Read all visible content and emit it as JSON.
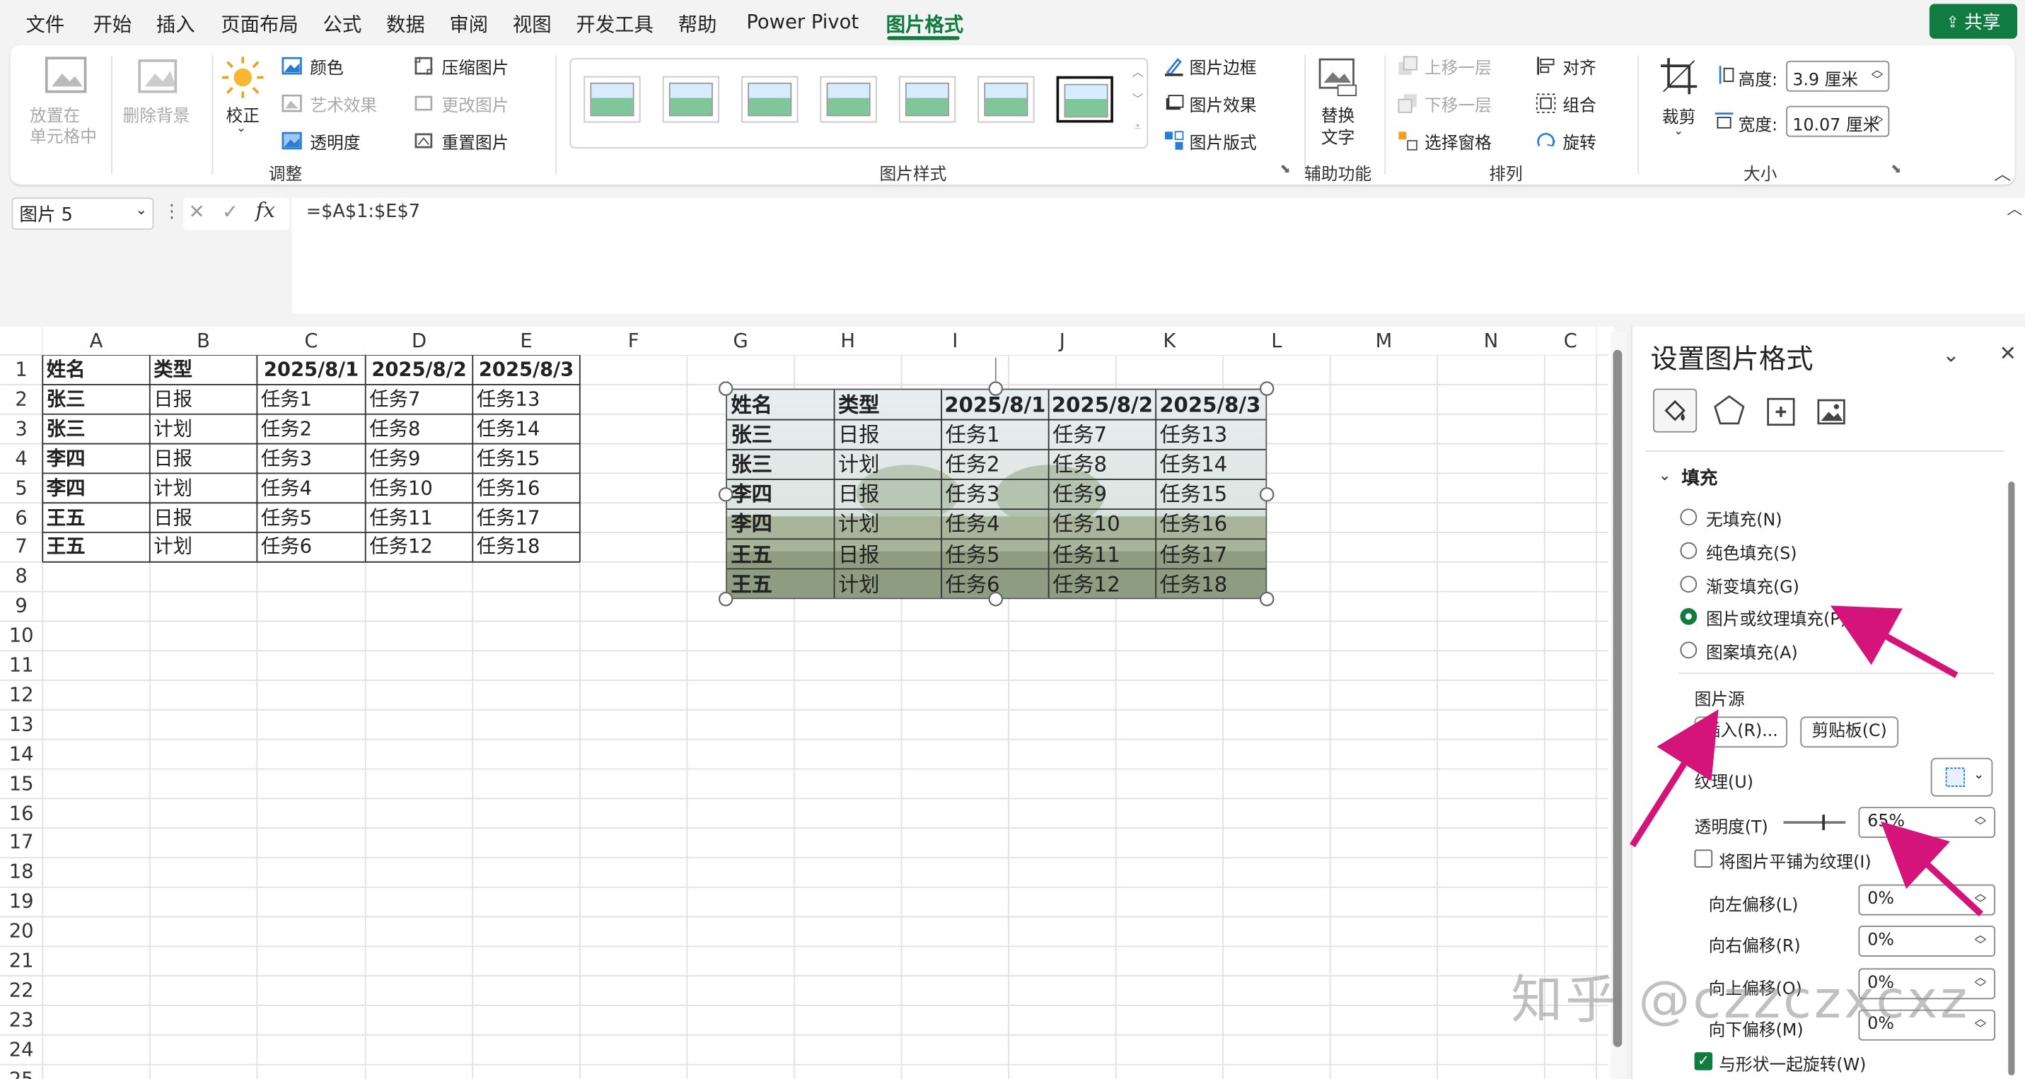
{
  "menu": {
    "items": [
      "文件",
      "开始",
      "插入",
      "页面布局",
      "公式",
      "数据",
      "审阅",
      "视图",
      "开发工具",
      "帮助",
      "Power Pivot",
      "图片格式"
    ],
    "active": "图片格式",
    "share_label": "共享",
    "accent": "#107c41"
  },
  "ribbon": {
    "adjust": {
      "group_label": "调整",
      "place_in_cell": [
        "放置在",
        "单元格中"
      ],
      "remove_bg": "删除背景",
      "correct": "校正",
      "color": "颜色",
      "artistic": "艺术效果",
      "transparency": "透明度",
      "compress": "压缩图片",
      "change": "更改图片",
      "reset": "重置图片"
    },
    "styles": {
      "group_label": "图片样式",
      "border": "图片边框",
      "effects": "图片效果",
      "layout": "图片版式"
    },
    "accessibility": {
      "group_label": "辅助功能",
      "alt_text": [
        "替换",
        "文字"
      ]
    },
    "arrange": {
      "group_label": "排列",
      "bring_forward": "上移一层",
      "send_backward": "下移一层",
      "selection_pane": "选择窗格",
      "align": "对齐",
      "group": "组合",
      "rotate": "旋转"
    },
    "size": {
      "group_label": "大小",
      "crop": "裁剪",
      "height_label": "高度:",
      "height_value": "3.9 厘米",
      "width_label": "宽度:",
      "width_value": "10.07 厘米"
    }
  },
  "formula_bar": {
    "name_box": "图片 5",
    "fx": "fx",
    "formula": "=$A$1:$E$7"
  },
  "sheet": {
    "columns": [
      "A",
      "B",
      "C",
      "D",
      "E",
      "F",
      "G",
      "H",
      "I",
      "J",
      "K",
      "L",
      "M",
      "N",
      "C"
    ],
    "rows": [
      "1",
      "2",
      "3",
      "4",
      "5",
      "6",
      "7",
      "8",
      "9",
      "10",
      "11",
      "12",
      "13",
      "14",
      "15",
      "16",
      "17",
      "18",
      "19",
      "20",
      "21",
      "22",
      "23",
      "24",
      "25"
    ],
    "table": {
      "headers": [
        "姓名",
        "类型",
        "2025/8/1",
        "2025/8/2",
        "2025/8/3"
      ],
      "rows": [
        [
          "张三",
          "日报",
          "任务1",
          "任务7",
          "任务13"
        ],
        [
          "张三",
          "计划",
          "任务2",
          "任务8",
          "任务14"
        ],
        [
          "李四",
          "日报",
          "任务3",
          "任务9",
          "任务15"
        ],
        [
          "李四",
          "计划",
          "任务4",
          "任务10",
          "任务16"
        ],
        [
          "王五",
          "日报",
          "任务5",
          "任务11",
          "任务17"
        ],
        [
          "王五",
          "计划",
          "任务6",
          "任务12",
          "任务18"
        ]
      ]
    }
  },
  "panel": {
    "title": "设置图片格式",
    "section": "填充",
    "fill_options": [
      "无填充(N)",
      "纯色填充(S)",
      "渐变填充(G)",
      "图片或纹理填充(P)",
      "图案填充(A)"
    ],
    "selected_fill": "图片或纹理填充(P)",
    "picture_source": "图片源",
    "insert_button": "插入(R)...",
    "clipboard_button": "剪贴板(C)",
    "texture_label": "纹理(U)",
    "transparency_label": "透明度(T)",
    "transparency_value": "65%",
    "transparency_level": 0.65,
    "tile_label": "将图片平铺为纹理(I)",
    "offsets": [
      {
        "label": "向左偏移(L)",
        "value": "0%"
      },
      {
        "label": "向右偏移(R)",
        "value": "0%"
      },
      {
        "label": "向上偏移(O)",
        "value": "0%"
      },
      {
        "label": "向下偏移(M)",
        "value": "0%"
      }
    ],
    "rotate_with_shape": "与形状一起旋转(W)"
  },
  "watermark": "知乎 @czzczxcxz",
  "annotation_color": "#d4147a"
}
